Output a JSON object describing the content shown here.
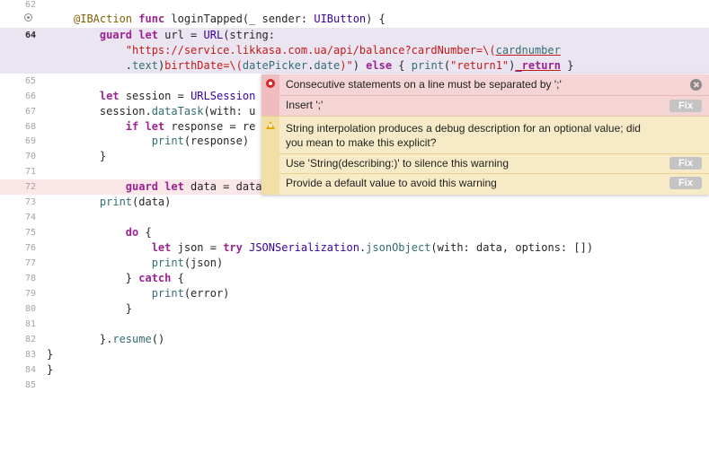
{
  "editor": {
    "lines": [
      {
        "n": "62",
        "tokens": []
      },
      {
        "n": "63",
        "tokens": [
          [
            "attr",
            "@IBAction"
          ],
          [
            "p",
            " "
          ],
          [
            "kw",
            "func"
          ],
          [
            "p",
            " loginTapped(_ sender: "
          ],
          [
            "type",
            "UIButton"
          ],
          [
            "p",
            ") {"
          ]
        ]
      },
      {
        "n": "64",
        "tokens": [
          [
            "p",
            "    "
          ],
          [
            "kw",
            "guard let"
          ],
          [
            "p",
            " url = "
          ],
          [
            "type",
            "URL"
          ],
          [
            "p",
            "(string:"
          ]
        ]
      },
      {
        "n": "",
        "tokens": [
          [
            "p",
            "        "
          ],
          [
            "str",
            "\"https://service.likkasa.com.ua/api/balance?cardNumber=\\("
          ],
          [
            "fnu",
            "cardnumber"
          ]
        ]
      },
      {
        "n": "",
        "tokens": [
          [
            "p",
            "        ."
          ],
          [
            "fn",
            "text"
          ],
          [
            "p",
            ")"
          ],
          [
            "str",
            "birthDate=\\("
          ],
          [
            "fn",
            "datePicker"
          ],
          [
            "p",
            "."
          ],
          [
            "fn",
            "date"
          ],
          [
            "str",
            ")\""
          ],
          [
            "p",
            ") "
          ],
          [
            "kw",
            "else"
          ],
          [
            "p",
            " { "
          ],
          [
            "fn",
            "print"
          ],
          [
            "p",
            "("
          ],
          [
            "str",
            "\"return1\""
          ],
          [
            "p",
            ")"
          ],
          [
            "kwu",
            "_return"
          ],
          [
            "p",
            " }"
          ]
        ]
      },
      {
        "n": "65",
        "tokens": []
      },
      {
        "n": "66",
        "tokens": [
          [
            "p",
            "    "
          ],
          [
            "kw",
            "let"
          ],
          [
            "p",
            " session = "
          ],
          [
            "type",
            "URLSession"
          ]
        ]
      },
      {
        "n": "67",
        "tokens": [
          [
            "p",
            "    session."
          ],
          [
            "fn",
            "dataTask"
          ],
          [
            "p",
            "(with: u"
          ]
        ]
      },
      {
        "n": "68",
        "tokens": [
          [
            "p",
            "        "
          ],
          [
            "kw",
            "if let"
          ],
          [
            "p",
            " response = re"
          ]
        ]
      },
      {
        "n": "69",
        "tokens": [
          [
            "p",
            "            "
          ],
          [
            "fn",
            "print"
          ],
          [
            "p",
            "(response)"
          ]
        ]
      },
      {
        "n": "70",
        "tokens": [
          [
            "p",
            "    }"
          ]
        ]
      },
      {
        "n": "71",
        "tokens": []
      },
      {
        "n": "72",
        "tokens": [
          [
            "p",
            "        "
          ],
          [
            "kw",
            "guard let"
          ],
          [
            "p",
            " data = data"
          ]
        ]
      },
      {
        "n": "73",
        "tokens": [
          [
            "p",
            "    "
          ],
          [
            "fn",
            "print"
          ],
          [
            "p",
            "(data)"
          ]
        ]
      },
      {
        "n": "74",
        "tokens": []
      },
      {
        "n": "75",
        "tokens": [
          [
            "p",
            "        "
          ],
          [
            "kw",
            "do"
          ],
          [
            "p",
            " {"
          ]
        ]
      },
      {
        "n": "76",
        "tokens": [
          [
            "p",
            "            "
          ],
          [
            "kw",
            "let"
          ],
          [
            "p",
            " json = "
          ],
          [
            "kw",
            "try"
          ],
          [
            "p",
            " "
          ],
          [
            "type",
            "JSONSerialization"
          ],
          [
            "p",
            "."
          ],
          [
            "fn",
            "jsonObject"
          ],
          [
            "p",
            "(with: data, options: [])"
          ]
        ]
      },
      {
        "n": "77",
        "tokens": [
          [
            "p",
            "            "
          ],
          [
            "fn",
            "print"
          ],
          [
            "p",
            "(json)"
          ]
        ]
      },
      {
        "n": "78",
        "tokens": [
          [
            "p",
            "        } "
          ],
          [
            "kw",
            "catch"
          ],
          [
            "p",
            " {"
          ]
        ]
      },
      {
        "n": "79",
        "tokens": [
          [
            "p",
            "            "
          ],
          [
            "fn",
            "print"
          ],
          [
            "p",
            "(error)"
          ]
        ]
      },
      {
        "n": "80",
        "tokens": [
          [
            "p",
            "        }"
          ]
        ]
      },
      {
        "n": "81",
        "tokens": []
      },
      {
        "n": "82",
        "tokens": [
          [
            "p",
            "    }."
          ],
          [
            "fn",
            "resume"
          ],
          [
            "p",
            "()"
          ]
        ]
      },
      {
        "n": "83",
        "tokens": [
          [
            "p",
            "}"
          ]
        ]
      },
      {
        "n": "84",
        "tokens": [
          [
            "p",
            "}"
          ]
        ]
      },
      {
        "n": "85",
        "tokens": []
      }
    ]
  },
  "popover": {
    "error": {
      "message": "Consecutive statements on a line must be separated by ';'",
      "fixit": "Insert ';'",
      "fix_label": "Fix"
    },
    "warning": {
      "message_line1": "String interpolation produces a debug description for an optional value; did",
      "message_line2": "you mean to make this explicit?",
      "fixit1": "Use 'String(describing:)' to silence this warning",
      "fixit2": "Provide a default value to avoid this warning",
      "fix1_label": "Fix",
      "fix2_label": "Fix"
    }
  },
  "colors": {
    "keyword": "#9b2393",
    "string": "#c41a16",
    "type": "#3900a0",
    "function": "#326d74",
    "attribute": "#815f03",
    "current_line": "#ebe5f2",
    "error_line": "#fbe7e7",
    "error_bg": "#f4d4d4",
    "warning_bg": "#f7ebc7"
  }
}
